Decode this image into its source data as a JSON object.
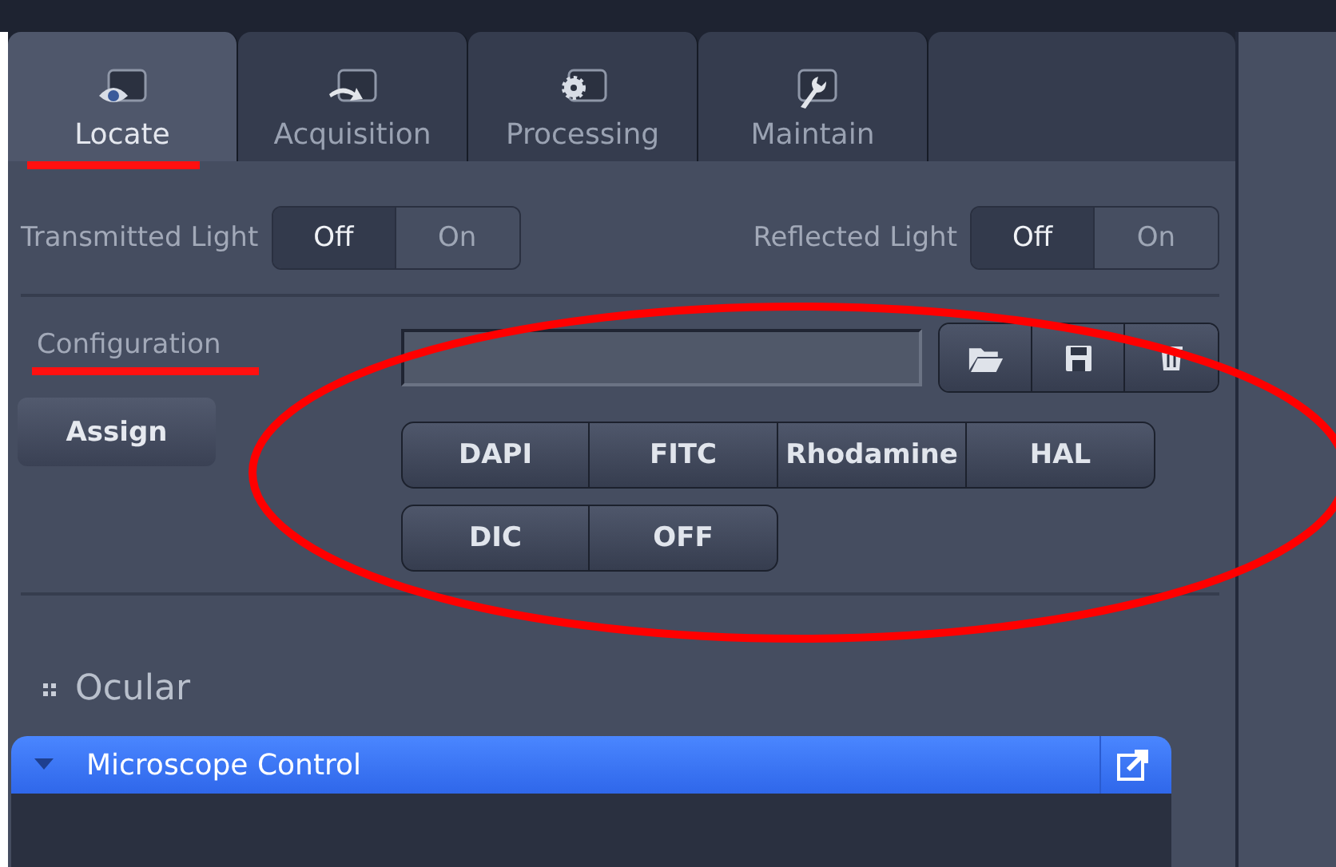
{
  "tabs": [
    {
      "label": "Locate",
      "selected": true,
      "underlined": true,
      "kind": "eye"
    },
    {
      "label": "Acquisition",
      "selected": false,
      "underlined": false,
      "kind": "arrow"
    },
    {
      "label": "Processing",
      "selected": false,
      "underlined": false,
      "kind": "gear"
    },
    {
      "label": "Maintain",
      "selected": false,
      "underlined": false,
      "kind": "wrench"
    }
  ],
  "light_toggles": [
    {
      "label": "Transmitted Light",
      "options": [
        {
          "label": "Off",
          "selected": true
        },
        {
          "label": "On",
          "selected": false
        }
      ]
    },
    {
      "label": "Reflected Light",
      "options": [
        {
          "label": "Off",
          "selected": true
        },
        {
          "label": "On",
          "selected": false
        }
      ]
    }
  ],
  "configuration": {
    "label": "Configuration",
    "underlined": true,
    "file_buttons": [
      {
        "kind": "open"
      },
      {
        "kind": "save"
      },
      {
        "kind": "delete"
      }
    ]
  },
  "assign_button": "Assign",
  "filter_buttons": {
    "highlight_ellipse": true,
    "rows": [
      [
        "DAPI",
        "FITC",
        "Rhodamine",
        "HAL"
      ],
      [
        "DIC",
        "OFF"
      ]
    ]
  },
  "ocular": "Ocular",
  "microscope_control": {
    "title": "Microscope Control",
    "expanded": true
  }
}
